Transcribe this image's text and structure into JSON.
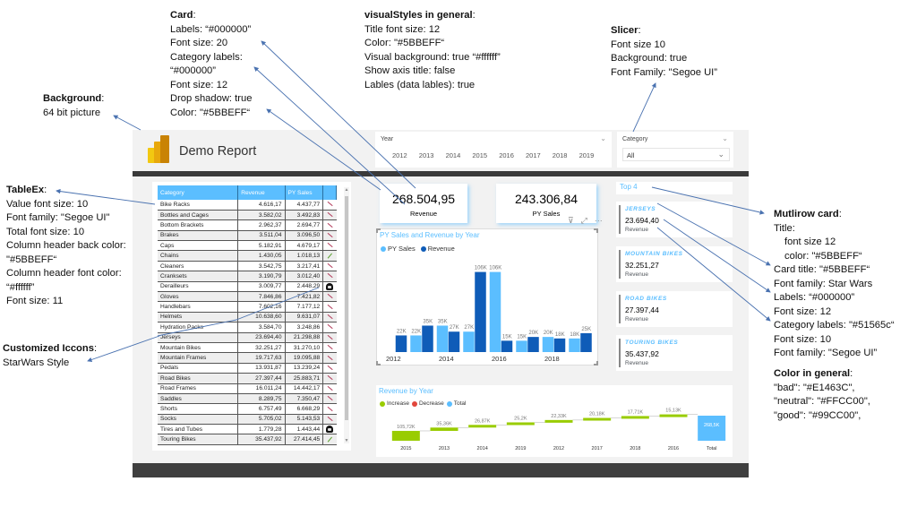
{
  "annotations": {
    "background": {
      "title": "Background",
      "lines": [
        "64 bit picture"
      ]
    },
    "card": {
      "title": "Card",
      "lines": [
        "Labels: “#000000”",
        "Font size: 20",
        "Category labels:",
        "“#000000”",
        "Font size: 12",
        "Drop shadow: true",
        "Color: \"#5BBEFF“"
      ]
    },
    "visual_styles": {
      "title": "visualStyles in general",
      "lines": [
        "Title font size: 12",
        "Color: \"#5BBEFF“",
        "Visual background: true “#ffffff”",
        "Show axis title: false",
        "Lables (data lables): true"
      ]
    },
    "slicer": {
      "title": "Slicer",
      "lines": [
        "Font size 10",
        "Background: true",
        "Font Family: \"Segoe UI”"
      ]
    },
    "tableex": {
      "title": "TableEx",
      "lines": [
        "Value font size: 10",
        "Font family: \"Segoe UI\"",
        "Total font size: 10",
        "Column header back color:",
        "\"#5BBEFF“",
        "Column header font color:",
        "“#ffffff”",
        "Font size: 11"
      ]
    },
    "icons": {
      "title": "Customized Iccons",
      "lines": [
        "StarWars Style"
      ]
    },
    "multirow": {
      "title": "Mutlirow card",
      "lines": [
        "Title:",
        "font size 12",
        "color: \"#5BBEFF“",
        "Card title: \"#5BBEFF“",
        "Font family: Star Wars",
        "Labels: “#000000”",
        "Font size: 12",
        "Category labels: \"#51565c“",
        "Font size: 10",
        "Font family: \"Segoe UI”"
      ]
    },
    "colors": {
      "title": "Color in general",
      "lines": [
        "\"bad\": \"#E1463C\",",
        "\"neutral\": \"#FFCC00\",",
        "\"good\": \"#99CC00\","
      ]
    }
  },
  "report": {
    "title": "Demo Report",
    "logo_icon": "power-bi-logo-icon",
    "slicer_year": {
      "label": "Year",
      "items": [
        "2012",
        "2013",
        "2014",
        "2015",
        "2016",
        "2017",
        "2018",
        "2019"
      ]
    },
    "slicer_category": {
      "label": "Category",
      "selected": "All"
    },
    "table": {
      "headers": [
        "Category",
        "Revenue",
        "PY Sales",
        ""
      ],
      "rows": [
        {
          "category": "Bike Racks",
          "revenue": "4.616,17",
          "py": "4.437,77",
          "icon": "red-lightsaber-icon"
        },
        {
          "category": "Bottles and Cages",
          "revenue": "3.582,02",
          "py": "3.492,83",
          "icon": "red-lightsaber-icon"
        },
        {
          "category": "Bottom Brackets",
          "revenue": "2.962,37",
          "py": "2.694,77",
          "icon": "red-lightsaber-icon"
        },
        {
          "category": "Brakes",
          "revenue": "3.511,04",
          "py": "3.096,50",
          "icon": "red-lightsaber-icon"
        },
        {
          "category": "Caps",
          "revenue": "5.182,91",
          "py": "4.679,17",
          "icon": "red-lightsaber-icon"
        },
        {
          "category": "Chains",
          "revenue": "1.430,05",
          "py": "1.018,13",
          "icon": "green-lightsaber-icon"
        },
        {
          "category": "Cleaners",
          "revenue": "3.542,75",
          "py": "3.217,41",
          "icon": "red-lightsaber-icon"
        },
        {
          "category": "Cranksets",
          "revenue": "3.190,79",
          "py": "3.012,40",
          "icon": "red-lightsaber-icon"
        },
        {
          "category": "Derailleurs",
          "revenue": "3.009,77",
          "py": "2.448,29",
          "icon": "vader-helmet-icon"
        },
        {
          "category": "Gloves",
          "revenue": "7.846,86",
          "py": "7.421,82",
          "icon": "red-lightsaber-icon"
        },
        {
          "category": "Handlebars",
          "revenue": "7.602,16",
          "py": "7.177,12",
          "icon": "red-lightsaber-icon"
        },
        {
          "category": "Helmets",
          "revenue": "10.638,60",
          "py": "9.631,07",
          "icon": "red-lightsaber-icon"
        },
        {
          "category": "Hydration Packs",
          "revenue": "3.584,70",
          "py": "3.248,86",
          "icon": "red-lightsaber-icon"
        },
        {
          "category": "Jerseys",
          "revenue": "23.694,40",
          "py": "21.298,88",
          "icon": "red-lightsaber-icon"
        },
        {
          "category": "Mountain Bikes",
          "revenue": "32.251,27",
          "py": "31.270,10",
          "icon": "red-lightsaber-icon"
        },
        {
          "category": "Mountain Frames",
          "revenue": "19.717,63",
          "py": "19.095,88",
          "icon": "red-lightsaber-icon"
        },
        {
          "category": "Pedals",
          "revenue": "13.931,87",
          "py": "13.239,24",
          "icon": "red-lightsaber-icon"
        },
        {
          "category": "Road Bikes",
          "revenue": "27.397,44",
          "py": "25.883,71",
          "icon": "red-lightsaber-icon"
        },
        {
          "category": "Road Frames",
          "revenue": "16.011,24",
          "py": "14.442,17",
          "icon": "red-lightsaber-icon"
        },
        {
          "category": "Saddles",
          "revenue": "8.289,75",
          "py": "7.350,47",
          "icon": "red-lightsaber-icon"
        },
        {
          "category": "Shorts",
          "revenue": "6.757,49",
          "py": "6.668,29",
          "icon": "red-lightsaber-icon"
        },
        {
          "category": "Socks",
          "revenue": "5.705,02",
          "py": "5.143,53",
          "icon": "red-lightsaber-icon"
        },
        {
          "category": "Tires and Tubes",
          "revenue": "1.779,28",
          "py": "1.443,44",
          "icon": "vader-helmet-icon"
        },
        {
          "category": "Touring Bikes",
          "revenue": "35.437,92",
          "py": "27.414,45",
          "icon": "green-lightsaber-icon"
        }
      ]
    },
    "card_revenue": {
      "value": "268.504,95",
      "label": "Revenue"
    },
    "card_py": {
      "value": "243.306,84",
      "label": "PY Sales"
    },
    "visual_tools": {
      "filter": "⊽",
      "focus": "⤢",
      "more": "···"
    },
    "multirow": {
      "title": "Top 4",
      "cards": [
        {
          "category": "JERSEYS",
          "value": "23.694,40",
          "label": "Revenue"
        },
        {
          "category": "MOUNTAIN BIKES",
          "value": "32.251,27",
          "label": "Revenue"
        },
        {
          "category": "ROAD BIKES",
          "value": "27.397,44",
          "label": "Revenue"
        },
        {
          "category": "TOURING BIKES",
          "value": "35.437,92",
          "label": "Revenue"
        }
      ]
    },
    "colors": {
      "accent": "#5BBEFF",
      "revenue": "#0F5CB8",
      "increase": "#99CC00",
      "decrease": "#E1463C",
      "total": "#5BBEFF"
    }
  },
  "chart_data": [
    {
      "type": "bar",
      "title": "PY Sales and Revenue by Year",
      "categories": [
        "2012",
        "2013",
        "2014",
        "2015",
        "2016",
        "2017",
        "2018",
        "2019"
      ],
      "x_tick_labels": [
        "2012",
        "2014",
        "2016",
        "2018"
      ],
      "series": [
        {
          "name": "PY Sales",
          "values": [
            null,
            22,
            35,
            27,
            106,
            15,
            20,
            18
          ],
          "labels": [
            "",
            "22K",
            "35K",
            "27K",
            "106K",
            "15K",
            "20K",
            "18K"
          ]
        },
        {
          "name": "Revenue",
          "values": [
            22,
            35,
            27,
            106,
            15,
            20,
            18,
            25
          ],
          "labels": [
            "22K",
            "35K",
            "27K",
            "106K",
            "15K",
            "20K",
            "18K",
            "25K"
          ]
        }
      ],
      "unit": "K",
      "legend": "top-left",
      "ylim": [
        0,
        115
      ],
      "xlabel": "",
      "ylabel": ""
    },
    {
      "type": "bar",
      "subtype": "waterfall",
      "title": "Revenue by Year",
      "legend_entries": [
        "Increase",
        "Decrease",
        "Total"
      ],
      "categories": [
        "2015",
        "2013",
        "2014",
        "2019",
        "2012",
        "2017",
        "2018",
        "2016",
        "Total"
      ],
      "values": [
        105.72,
        35.36,
        26.87,
        25.2,
        22.33,
        20.18,
        17.71,
        15.13,
        268.5
      ],
      "labels": [
        "105,72K",
        "35,36K",
        "26,87K",
        "25,2K",
        "22,33K",
        "20,18K",
        "17,71K",
        "15,13K",
        "268,5K"
      ],
      "unit": "K",
      "legend": "top-left",
      "xlabel": "",
      "ylabel": ""
    }
  ]
}
